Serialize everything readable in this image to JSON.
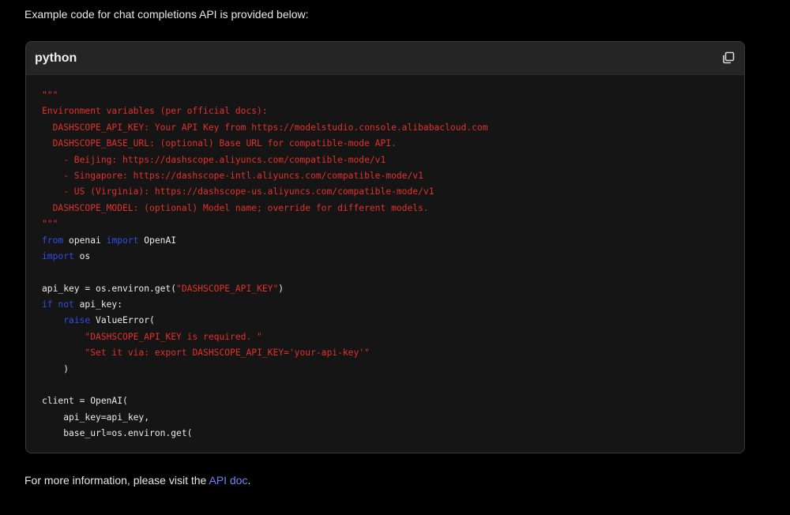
{
  "intro_text": "Example code for chat completions API is provided below:",
  "code_block": {
    "language": "python",
    "copy_icon": "copy-icon",
    "lines": [
      [
        {
          "t": "\"\"\"",
          "c": "str"
        }
      ],
      [
        {
          "t": "Environment variables (per official docs):",
          "c": "str"
        }
      ],
      [
        {
          "t": "  DASHSCOPE_API_KEY: Your API Key from https://modelstudio.console.alibabacloud.com",
          "c": "str"
        }
      ],
      [
        {
          "t": "  DASHSCOPE_BASE_URL: (optional) Base URL for compatible-mode API.",
          "c": "str"
        }
      ],
      [
        {
          "t": "    - Beijing: https://dashscope.aliyuncs.com/compatible-mode/v1",
          "c": "str"
        }
      ],
      [
        {
          "t": "    - Singapore: https://dashscope-intl.aliyuncs.com/compatible-mode/v1",
          "c": "str"
        }
      ],
      [
        {
          "t": "    - US (Virginia): https://dashscope-us.aliyuncs.com/compatible-mode/v1",
          "c": "str"
        }
      ],
      [
        {
          "t": "  DASHSCOPE_MODEL: (optional) Model name; override for different models.",
          "c": "str"
        }
      ],
      [
        {
          "t": "\"\"\"",
          "c": "str"
        }
      ],
      [
        {
          "t": "from",
          "c": "kw"
        },
        {
          "t": " openai ",
          "c": "plain"
        },
        {
          "t": "import",
          "c": "kw"
        },
        {
          "t": " OpenAI",
          "c": "plain"
        }
      ],
      [
        {
          "t": "import",
          "c": "kw"
        },
        {
          "t": " os",
          "c": "plain"
        }
      ],
      [],
      [
        {
          "t": "api_key = os.environ.get(",
          "c": "plain"
        },
        {
          "t": "\"DASHSCOPE_API_KEY\"",
          "c": "str"
        },
        {
          "t": ")",
          "c": "plain"
        }
      ],
      [
        {
          "t": "if",
          "c": "kw"
        },
        {
          "t": " ",
          "c": "plain"
        },
        {
          "t": "not",
          "c": "kw"
        },
        {
          "t": " api_key:",
          "c": "plain"
        }
      ],
      [
        {
          "t": "    ",
          "c": "plain"
        },
        {
          "t": "raise",
          "c": "kw"
        },
        {
          "t": " ValueError(",
          "c": "plain"
        }
      ],
      [
        {
          "t": "        ",
          "c": "plain"
        },
        {
          "t": "\"DASHSCOPE_API_KEY is required. \"",
          "c": "str"
        }
      ],
      [
        {
          "t": "        ",
          "c": "plain"
        },
        {
          "t": "\"Set it via: export DASHSCOPE_API_KEY='your-api-key'\"",
          "c": "str"
        }
      ],
      [
        {
          "t": "    )",
          "c": "plain"
        }
      ],
      [],
      [
        {
          "t": "client = OpenAI(",
          "c": "plain"
        }
      ],
      [
        {
          "t": "    api_key=api_key,",
          "c": "plain"
        }
      ],
      [
        {
          "t": "    base_url=os.environ.get(",
          "c": "plain"
        }
      ]
    ]
  },
  "outro": {
    "prefix": "For more information, please visit the ",
    "link_label": "API doc",
    "suffix": "."
  },
  "colors": {
    "string": "#e2312c",
    "keyword": "#2f4ee8",
    "link": "#6f83ff"
  }
}
